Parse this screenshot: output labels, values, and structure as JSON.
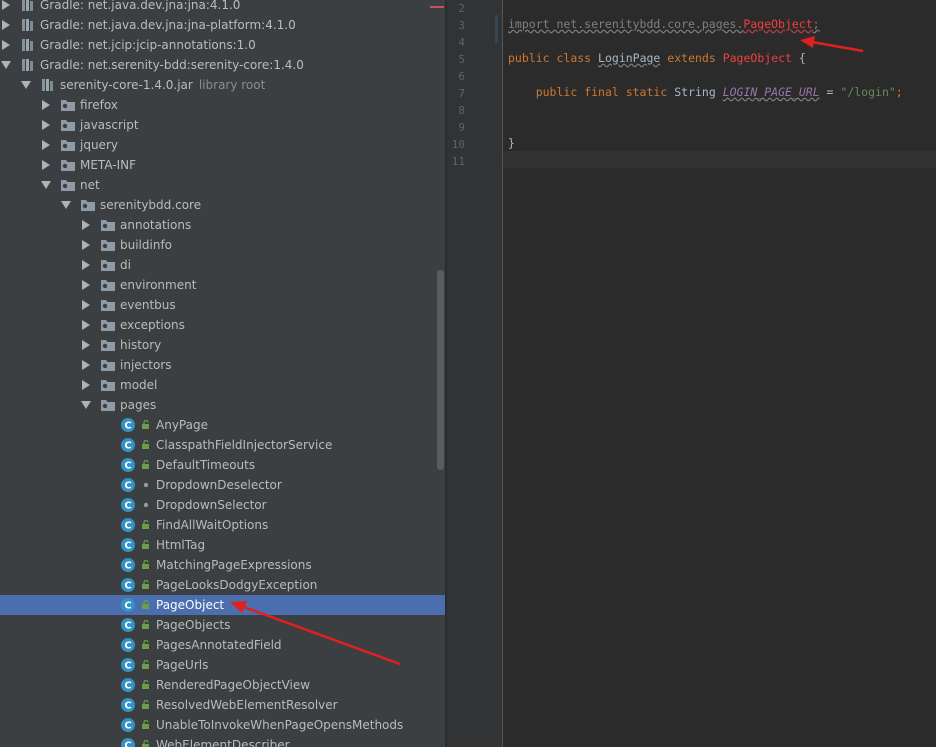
{
  "project_tree": {
    "rows": [
      {
        "label": "Gradle: net.java.dev.jna:jna:4.1.0",
        "sub": "",
        "depth": 0,
        "arrow": "right",
        "icon": "library-icon",
        "selected": false
      },
      {
        "label": "Gradle: net.java.dev.jna:jna-platform:4.1.0",
        "sub": "",
        "depth": 0,
        "arrow": "right",
        "icon": "library-icon",
        "selected": false
      },
      {
        "label": "Gradle: net.jcip:jcip-annotations:1.0",
        "sub": "",
        "depth": 0,
        "arrow": "right",
        "icon": "library-icon",
        "selected": false
      },
      {
        "label": "Gradle: net.serenity-bdd:serenity-core:1.4.0",
        "sub": "",
        "depth": 0,
        "arrow": "down",
        "icon": "library-icon",
        "selected": false
      },
      {
        "label": "serenity-core-1.4.0.jar",
        "sub": "library root",
        "depth": 1,
        "arrow": "down",
        "icon": "jar-icon",
        "selected": false
      },
      {
        "label": "firefox",
        "sub": "",
        "depth": 2,
        "arrow": "right",
        "icon": "package-icon",
        "selected": false
      },
      {
        "label": "javascript",
        "sub": "",
        "depth": 2,
        "arrow": "right",
        "icon": "package-icon",
        "selected": false
      },
      {
        "label": "jquery",
        "sub": "",
        "depth": 2,
        "arrow": "right",
        "icon": "package-icon",
        "selected": false
      },
      {
        "label": "META-INF",
        "sub": "",
        "depth": 2,
        "arrow": "right",
        "icon": "package-icon",
        "selected": false
      },
      {
        "label": "net",
        "sub": "",
        "depth": 2,
        "arrow": "down",
        "icon": "package-icon",
        "selected": false
      },
      {
        "label": "serenitybdd.core",
        "sub": "",
        "depth": 3,
        "arrow": "down",
        "icon": "package-icon",
        "selected": false
      },
      {
        "label": "annotations",
        "sub": "",
        "depth": 4,
        "arrow": "right",
        "icon": "package-icon",
        "selected": false
      },
      {
        "label": "buildinfo",
        "sub": "",
        "depth": 4,
        "arrow": "right",
        "icon": "package-icon",
        "selected": false
      },
      {
        "label": "di",
        "sub": "",
        "depth": 4,
        "arrow": "right",
        "icon": "package-icon",
        "selected": false
      },
      {
        "label": "environment",
        "sub": "",
        "depth": 4,
        "arrow": "right",
        "icon": "package-icon",
        "selected": false
      },
      {
        "label": "eventbus",
        "sub": "",
        "depth": 4,
        "arrow": "right",
        "icon": "package-icon",
        "selected": false
      },
      {
        "label": "exceptions",
        "sub": "",
        "depth": 4,
        "arrow": "right",
        "icon": "package-icon",
        "selected": false
      },
      {
        "label": "history",
        "sub": "",
        "depth": 4,
        "arrow": "right",
        "icon": "package-icon",
        "selected": false
      },
      {
        "label": "injectors",
        "sub": "",
        "depth": 4,
        "arrow": "right",
        "icon": "package-icon",
        "selected": false
      },
      {
        "label": "model",
        "sub": "",
        "depth": 4,
        "arrow": "right",
        "icon": "package-icon",
        "selected": false
      },
      {
        "label": "pages",
        "sub": "",
        "depth": 4,
        "arrow": "down",
        "icon": "package-icon",
        "selected": false
      },
      {
        "label": "AnyPage",
        "sub": "",
        "depth": 5,
        "arrow": "none",
        "icon": "class-icon",
        "vis": "public",
        "selected": false
      },
      {
        "label": "ClasspathFieldInjectorService",
        "sub": "",
        "depth": 5,
        "arrow": "none",
        "icon": "class-icon",
        "vis": "public",
        "selected": false
      },
      {
        "label": "DefaultTimeouts",
        "sub": "",
        "depth": 5,
        "arrow": "none",
        "icon": "class-icon",
        "vis": "public",
        "selected": false
      },
      {
        "label": "DropdownDeselector",
        "sub": "",
        "depth": 5,
        "arrow": "none",
        "icon": "class-icon",
        "vis": "package",
        "selected": false
      },
      {
        "label": "DropdownSelector",
        "sub": "",
        "depth": 5,
        "arrow": "none",
        "icon": "class-icon",
        "vis": "package",
        "selected": false
      },
      {
        "label": "FindAllWaitOptions",
        "sub": "",
        "depth": 5,
        "arrow": "none",
        "icon": "class-icon",
        "vis": "public",
        "selected": false
      },
      {
        "label": "HtmlTag",
        "sub": "",
        "depth": 5,
        "arrow": "none",
        "icon": "class-icon",
        "vis": "public",
        "selected": false
      },
      {
        "label": "MatchingPageExpressions",
        "sub": "",
        "depth": 5,
        "arrow": "none",
        "icon": "class-icon",
        "vis": "public",
        "selected": false
      },
      {
        "label": "PageLooksDodgyException",
        "sub": "",
        "depth": 5,
        "arrow": "none",
        "icon": "class-icon",
        "vis": "public",
        "selected": false
      },
      {
        "label": "PageObject",
        "sub": "",
        "depth": 5,
        "arrow": "none",
        "icon": "class-icon",
        "vis": "public",
        "selected": true
      },
      {
        "label": "PageObjects",
        "sub": "",
        "depth": 5,
        "arrow": "none",
        "icon": "class-icon",
        "vis": "public",
        "selected": false
      },
      {
        "label": "PagesAnnotatedField",
        "sub": "",
        "depth": 5,
        "arrow": "none",
        "icon": "class-icon",
        "vis": "public",
        "selected": false
      },
      {
        "label": "PageUrls",
        "sub": "",
        "depth": 5,
        "arrow": "none",
        "icon": "class-icon",
        "vis": "public",
        "selected": false
      },
      {
        "label": "RenderedPageObjectView",
        "sub": "",
        "depth": 5,
        "arrow": "none",
        "icon": "class-icon",
        "vis": "public",
        "selected": false
      },
      {
        "label": "ResolvedWebElementResolver",
        "sub": "",
        "depth": 5,
        "arrow": "none",
        "icon": "class-icon",
        "vis": "public",
        "selected": false
      },
      {
        "label": "UnableToInvokeWhenPageOpensMethods",
        "sub": "",
        "depth": 5,
        "arrow": "none",
        "icon": "class-icon",
        "vis": "public",
        "selected": false
      },
      {
        "label": "WebElementDescriber",
        "sub": "",
        "depth": 5,
        "arrow": "none",
        "icon": "class-icon",
        "vis": "public",
        "selected": false
      }
    ]
  },
  "editor": {
    "line_numbers": [
      "2",
      "3",
      "4",
      "5",
      "6",
      "7",
      "8",
      "9",
      "10",
      "11"
    ],
    "code": {
      "import_kw": "import",
      "import_pkg": " net.serenitybdd.core.pages.",
      "import_cls": "PageObject",
      "import_semi": ";",
      "public_kw": "public",
      "class_kw": "class",
      "class_name": "LoginPage",
      "extends_kw": "extends",
      "super_cls": "PageObject",
      "open_brace": "{",
      "field_mods": "public final static",
      "field_type": "String",
      "field_name": "LOGIN_PAGE_URL",
      "assign": " = ",
      "field_value": "\"/login\"",
      "field_semi": ";",
      "close_brace": "}"
    }
  },
  "colors": {
    "tree_bg": "#3c3f41",
    "selection": "#4b6eaf",
    "editor_bg": "#2b2b2b",
    "annotation_arrow": "#e02020"
  }
}
